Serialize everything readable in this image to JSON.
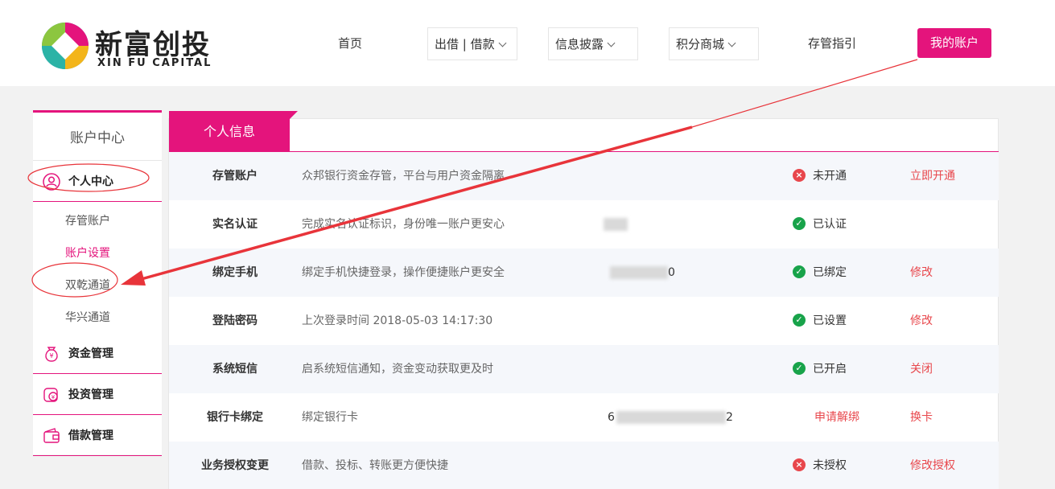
{
  "brand": {
    "name": "新富创投",
    "sub": "XIN FU CAPITAL"
  },
  "nav": {
    "home": "首页",
    "lend_borrow": "出借 | 借款",
    "disclosure": "信息披露",
    "points_mall": "积分商城",
    "custody_guide": "存管指引",
    "my_account": "我的账户"
  },
  "sidebar": {
    "title": "账户中心",
    "personal_center": "个人中心",
    "subs": [
      "存管账户",
      "账户设置",
      "双乾通道",
      "华兴通道"
    ],
    "fund_mgmt": "资金管理",
    "invest_mgmt": "投资管理",
    "loan_mgmt": "借款管理"
  },
  "tab": {
    "label": "个人信息"
  },
  "rows": [
    {
      "label": "存管账户",
      "desc": "众邦银行资金存管，平台与用户资金隔离",
      "value": "",
      "status": "未开通",
      "status_ok": false,
      "action": "立即开通"
    },
    {
      "label": "实名认证",
      "desc": "完成实名认证标识，身份唯一账户更安心",
      "value": "",
      "status": "已认证",
      "status_ok": true,
      "action": ""
    },
    {
      "label": "绑定手机",
      "desc": "绑定手机快捷登录，操作便捷账户更安全",
      "value": "0",
      "status": "已绑定",
      "status_ok": true,
      "action": "修改"
    },
    {
      "label": "登陆密码",
      "desc": "上次登录时间  2018-05-03 14:17:30",
      "value": "",
      "status": "已设置",
      "status_ok": true,
      "action": "修改"
    },
    {
      "label": "系统短信",
      "desc": "启系统短信通知，资金变动获取更及时",
      "value": "",
      "status": "已开启",
      "status_ok": true,
      "action": "关闭"
    },
    {
      "label": "银行卡绑定",
      "desc": "绑定银行卡",
      "value": "6",
      "value_tail": "2",
      "status": "申请解绑",
      "status_ok": null,
      "action": "换卡"
    },
    {
      "label": "业务授权变更",
      "desc": "借款、投标、转账更方便快捷",
      "value": "",
      "status": "未授权",
      "status_ok": false,
      "action": "修改授权"
    }
  ],
  "colors": {
    "accent": "#e4147c",
    "danger": "#e8474c",
    "ok": "#18a34a"
  }
}
